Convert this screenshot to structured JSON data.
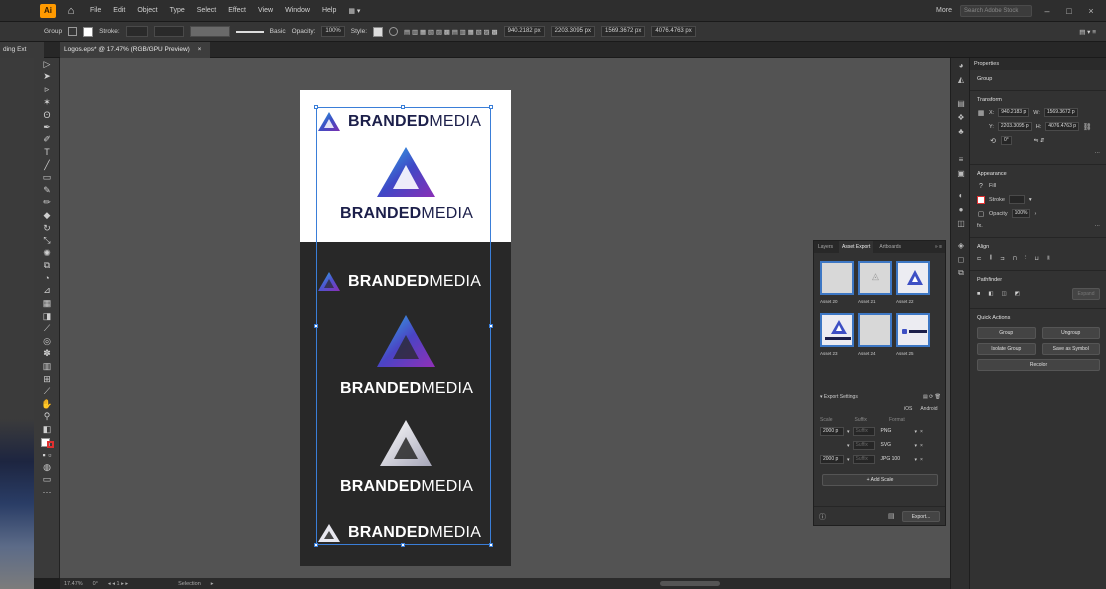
{
  "menubar": {
    "app_abbrev": "Ai",
    "items": [
      "File",
      "Edit",
      "Object",
      "Type",
      "Select",
      "Effect",
      "View",
      "Window",
      "Help"
    ],
    "workspace": "More",
    "search_placeholder": "Search Adobe Stock"
  },
  "controlbar": {
    "selection_label": "Group",
    "stroke_label": "Stroke:",
    "basic_label": "Basic",
    "opacity_label": "Opacity:",
    "opacity_value": "100%",
    "style_label": "Style:",
    "x_value": "940.2182 px",
    "y_value": "2203.3095 px",
    "w_value": "1569.3672 px",
    "h_value": "4076.4763 px"
  },
  "tabs": {
    "previous": "ding Ext",
    "active": "Logos.eps* @ 17.47% (RGB/GPU Preview)",
    "close": "×"
  },
  "canvas": {
    "brand_bold": "BRANDED",
    "brand_light": "MEDIA",
    "light_bg": "#ffffff",
    "dark_bg": "#282828",
    "brand_navy": "#1c1f4a",
    "selection_color": "#3a7ed8"
  },
  "statusbar": {
    "zoom": "17.47%",
    "angle": "0°",
    "artboard": "1",
    "tool": "Selection"
  },
  "properties": {
    "tab": "Properties",
    "selection": "Group",
    "transform": {
      "title": "Transform",
      "x_label": "X:",
      "x": "940.2183 p",
      "y_label": "Y:",
      "y": "2203.3095 p",
      "w_label": "W:",
      "w": "1569.3672 p",
      "h_label": "H:",
      "h": "4076.4763 p",
      "angle": "0°"
    },
    "appearance": {
      "title": "Appearance",
      "fill_label": "Fill",
      "stroke_label": "Stroke",
      "opacity_label": "Opacity",
      "opacity_value": "100%",
      "fx_label": "fx."
    },
    "align": {
      "title": "Align"
    },
    "pathfinder": {
      "title": "Pathfinder",
      "expand": "Expand"
    },
    "quick_actions": {
      "title": "Quick Actions",
      "group": "Group",
      "ungroup": "Ungroup",
      "isolate": "Isolate Group",
      "save_symbol": "Save as Symbol",
      "recolor": "Recolor"
    }
  },
  "asset_export": {
    "tabs": [
      "Layers",
      "Asset Export",
      "Artboards"
    ],
    "assets": [
      "Asset 20",
      "Asset 21",
      "Asset 22",
      "Asset 23",
      "Asset 24",
      "Asset 25"
    ],
    "export_settings": "Export Settings",
    "ios": "iOS",
    "android": "Android",
    "col_scale": "Scale",
    "col_suffix": "Suffix",
    "col_format": "Format",
    "rows": [
      {
        "scale": "2000 p",
        "suffix": "Suffix",
        "format": "PNG"
      },
      {
        "scale": "",
        "suffix": "Suffix",
        "format": "SVG"
      },
      {
        "scale": "2000 p",
        "suffix": "Suffix",
        "format": "JPG 100"
      }
    ],
    "add_scale": "+ Add Scale",
    "export_button": "Export..."
  }
}
